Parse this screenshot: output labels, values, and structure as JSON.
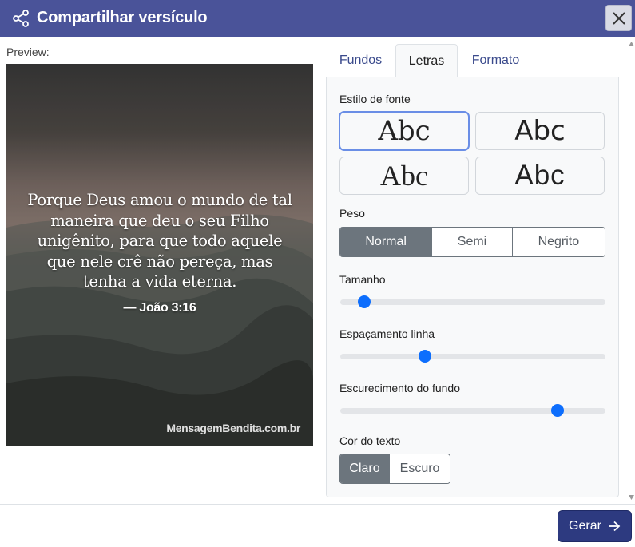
{
  "dialog": {
    "title": "Compartilhar versículo",
    "close_icon": "close-icon",
    "share_icon": "share-icon"
  },
  "preview": {
    "label": "Preview:",
    "verse": "Porque Deus amou o mundo de tal maneira que deu o seu Filho unigênito, para que todo aquele que nele crê não pereça, mas tenha a vida eterna.",
    "reference": "— João 3:16",
    "watermark": "MensagemBendita.com.br"
  },
  "tabs": [
    {
      "label": "Fundos",
      "active": false
    },
    {
      "label": "Letras",
      "active": true
    },
    {
      "label": "Formato",
      "active": false
    }
  ],
  "letras": {
    "font_style_label": "Estilo de fonte",
    "font_options": [
      {
        "sample": "Abc",
        "selected": true
      },
      {
        "sample": "Abc",
        "selected": false
      },
      {
        "sample": "Abc",
        "selected": false
      },
      {
        "sample": "Abc",
        "selected": false
      }
    ],
    "weight_label": "Peso",
    "weight_options": [
      "Normal",
      "Semi",
      "Negrito"
    ],
    "weight_selected": "Normal",
    "size_label": "Tamanho",
    "size_value": 0.09,
    "line_spacing_label": "Espaçamento linha",
    "line_spacing_value": 0.32,
    "darken_label": "Escurecimento do fundo",
    "darken_value": 0.82,
    "text_color_label": "Cor do texto",
    "text_color_options": [
      "Claro",
      "Escuro"
    ],
    "text_color_selected": "Claro"
  },
  "footer": {
    "generate_label": "Gerar",
    "generate_icon": "arrow-right-icon"
  },
  "colors": {
    "titlebar": "#4a5399",
    "primary_button": "#2d3a80",
    "slider_thumb": "#0d6efd",
    "segment_active": "#6c757d"
  }
}
